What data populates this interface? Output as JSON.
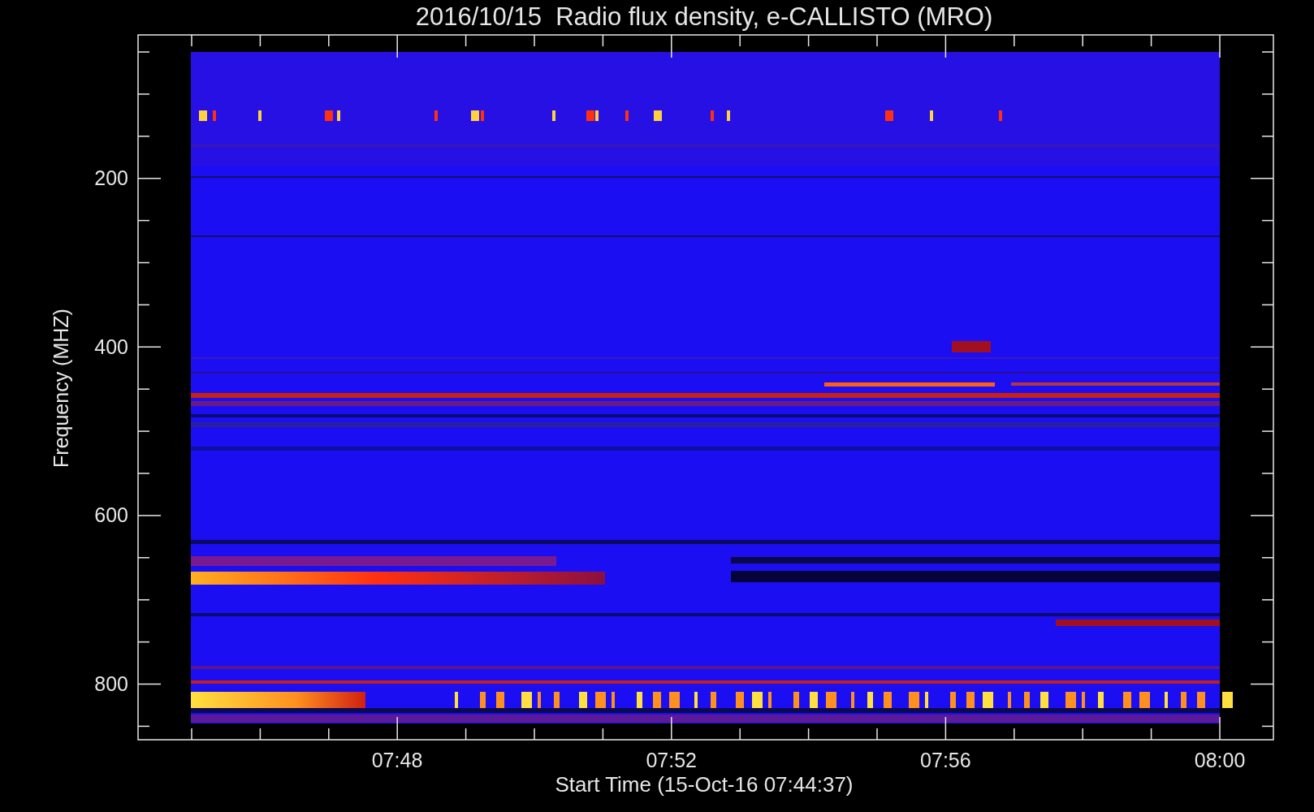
{
  "title": "2016/10/15  Radio flux density, e-CALLISTO (MRO)",
  "y_axis": {
    "label": "Frequency (MHZ)",
    "ticks": [
      "200",
      "400",
      "600",
      "800"
    ]
  },
  "x_axis": {
    "label": "Start Time (15-Oct-16 07:44:37)",
    "ticks": [
      "07:48",
      "07:52",
      "07:56",
      "08:00"
    ]
  }
}
